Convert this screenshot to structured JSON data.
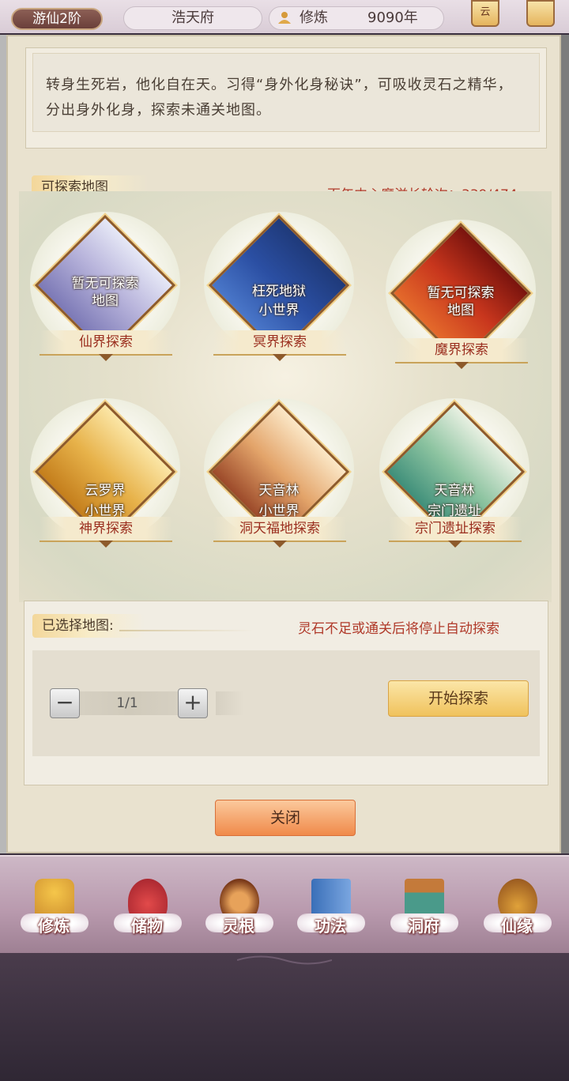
{
  "header": {
    "rank": "游仙2阶",
    "location": "浩天府",
    "cultivation_label": "修炼",
    "cultivation_value": "9090年",
    "right_button_text": "云"
  },
  "description": "转身生死岩，他化自在天。习得“身外化身秘诀”，可吸收灵石之精华，分出身外化身，探索未通关地图。",
  "explore": {
    "title": "可探索地图",
    "counter": "百年内心魔滋长轮次：339/474",
    "maps": [
      {
        "line1": "暂无可探索",
        "line2": "地图",
        "realm": "仙界探索"
      },
      {
        "line1": "枉死地狱",
        "line2": "小世界",
        "realm": "冥界探索"
      },
      {
        "line1": "暂无可探索",
        "line2": "地图",
        "realm": "魔界探索"
      },
      {
        "line1": "云罗界",
        "line2": "小世界",
        "realm": "神界探索"
      },
      {
        "line1": "天音林",
        "line2": "小世界",
        "realm": "洞天福地探索"
      },
      {
        "line1": "天音林",
        "line2": "宗门遗址",
        "realm": "宗门遗址探索"
      }
    ]
  },
  "selection": {
    "title": "已选择地图:",
    "warning": "灵石不足或通关后将停止自动探索",
    "stepper_value": "1/1",
    "minus": "−",
    "plus": "+",
    "start_button": "开始探索"
  },
  "close_button": "关闭",
  "nav": [
    {
      "label": "修炼",
      "icon": "monk-icon"
    },
    {
      "label": "储物",
      "icon": "pouch-icon"
    },
    {
      "label": "灵根",
      "icon": "spiral-orb-icon"
    },
    {
      "label": "功法",
      "icon": "book-icon"
    },
    {
      "label": "洞府",
      "icon": "pavilion-icon"
    },
    {
      "label": "仙缘",
      "icon": "gourd-icon"
    }
  ]
}
